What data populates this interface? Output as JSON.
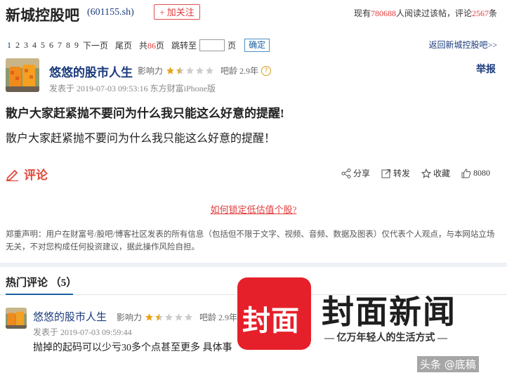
{
  "header": {
    "title": "新城控股吧",
    "code": "(601155.sh)",
    "follow_label": "+ 加关注",
    "reads_prefix": "现有",
    "reads": "780688",
    "reads_mid": "人阅读过该帖，评论",
    "comments": "2567",
    "comments_suffix": "条"
  },
  "pager": {
    "pages": [
      "1",
      "2",
      "3",
      "4",
      "5",
      "6",
      "7",
      "8",
      "9"
    ],
    "next": "下一页",
    "last": "尾页",
    "total_prefix": "共",
    "total": "86",
    "total_suffix": "页",
    "jump_to": "跳转至",
    "page_unit": "页",
    "confirm": "确定",
    "back": "返回新城控股吧>>"
  },
  "post": {
    "username": "悠悠的股市人生",
    "influence_label": "影响力",
    "rating": 1.5,
    "age": "吧龄 2.9年",
    "report": "举报",
    "time": "发表于 2019-07-03 09:53:16 东方财富iPhone版",
    "title": "散户大家赶紧抛不要问为什么我只能这么好意的提醒!",
    "body": "散户大家赶紧抛不要问为什么我只能这么好意的提醒！"
  },
  "actions": {
    "comment": "评论",
    "share": "分享",
    "forward": "转发",
    "collect": "收藏",
    "likes": "8080"
  },
  "ad_link": "如何锁定低估值个股?",
  "disclaimer": "郑重声明：用户在财富号/股吧/博客社区发表的所有信息（包括但不限于文字、视频、音频、数据及图表）仅代表个人观点，与本网站立场无关，不对您构成任何投资建议，据此操作风险自担。",
  "hot": {
    "title": "热门评论",
    "count": "（5）"
  },
  "comment1": {
    "username": "悠悠的股市人生",
    "influence_label": "影响力",
    "age": "吧龄 2.9年",
    "time": "发表于 2019-07-03 09:59:44",
    "text": "抛掉的起码可以少亏30多个点甚至更多 具体事"
  },
  "watermark": {
    "logo": "封面",
    "brand": "封面新闻",
    "slogan": "— 亿万年轻人的生活方式 —",
    "source": "头条 @底稿"
  },
  "colors": {
    "link_blue": "#1a3a7c",
    "accent_red": "#e03b3b",
    "logo_red": "#e6202a"
  }
}
